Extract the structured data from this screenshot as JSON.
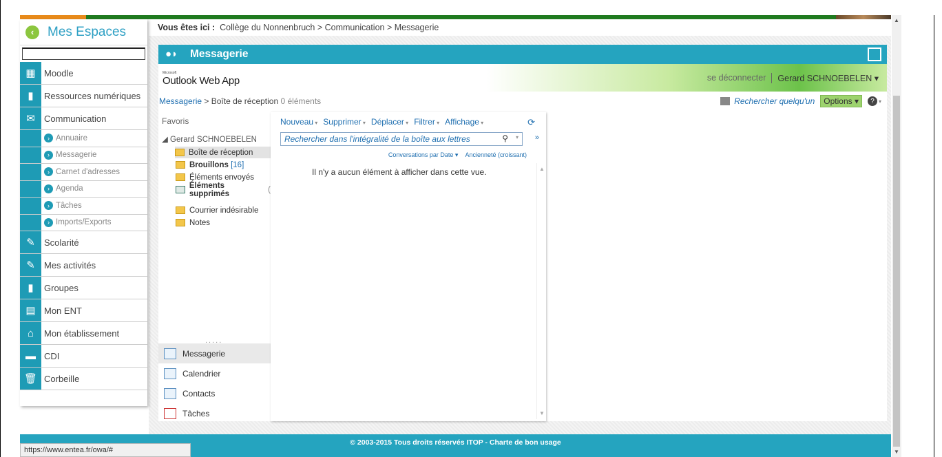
{
  "sidebar": {
    "title": "Mes Espaces",
    "items": [
      {
        "label": "Moodle",
        "icon": "moodle-icon"
      },
      {
        "label": "Ressources numériques",
        "icon": "book-icon"
      },
      {
        "label": "Communication",
        "icon": "mail-icon"
      }
    ],
    "subitems": [
      "Annuaire",
      "Messagerie",
      "Carnet d'adresses",
      "Agenda",
      "Tâches",
      "Imports/Exports"
    ],
    "items2": [
      {
        "label": "Scolarité",
        "icon": "notebook-icon"
      },
      {
        "label": "Mes activités",
        "icon": "notebook-icon"
      },
      {
        "label": "Groupes",
        "icon": "book-icon"
      },
      {
        "label": "Mon ENT",
        "icon": "layout-icon"
      },
      {
        "label": "Mon établissement",
        "icon": "home-icon"
      },
      {
        "label": "CDI",
        "icon": "library-icon"
      },
      {
        "label": "Corbeille",
        "icon": "trash-icon"
      }
    ]
  },
  "breadcrumb": {
    "prefix": "Vous êtes ici :",
    "path": "Collège du Nonnenbruch > Communication > Messagerie"
  },
  "panel": {
    "title": "Messagerie"
  },
  "owa": {
    "logo_small": "Microsoft",
    "logo": "Outlook Web App",
    "logout": "se déconnecter",
    "user": "Gerard SCHNOEBELEN ▾",
    "crumb_link": "Messagerie",
    "crumb_sep": ">",
    "crumb_folder": "Boîte de réception",
    "crumb_count": "0 éléments",
    "find_person": "Rechercher quelqu'un",
    "options": "Options ▾",
    "help": "?",
    "favorites": "Favoris",
    "account": "◢ Gerard SCHNOEBELEN",
    "folders": {
      "inbox": "Boîte de réception",
      "drafts": "Brouillons",
      "drafts_count": "[16]",
      "sent": "Éléments envoyés",
      "deleted": "Éléments supprimés",
      "deleted_count": "(",
      "junk": "Courrier indésirable",
      "notes": "Notes"
    },
    "dots": ".....",
    "nav": [
      "Messagerie",
      "Calendrier",
      "Contacts",
      "Tâches"
    ],
    "toolbar": [
      "Nouveau",
      "Supprimer",
      "Déplacer",
      "Filtrer",
      "Affichage"
    ],
    "search_placeholder": "Rechercher dans l'intégralité de la boîte aux lettres",
    "sort_by": "Conversations par Date ▾",
    "sort_order": "Ancienneté (croissant)",
    "empty_message": "Il n'y a aucun élément à afficher dans cette vue."
  },
  "footer": {
    "text": "© 2003-2015 Tous droits réservés ITOP  - Charte de bon usage"
  },
  "status_url": "https://www.entea.fr/owa/#"
}
